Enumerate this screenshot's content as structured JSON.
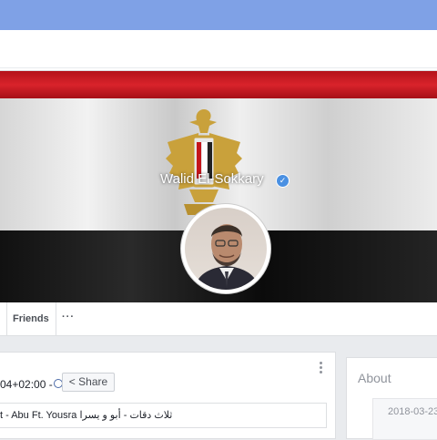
{
  "profile": {
    "name": "Walid El-Sokkary",
    "verified_icon": "verified-check-icon"
  },
  "tabs": {
    "friends_label": "Friends",
    "more_label": "···"
  },
  "post": {
    "timestamp": "04+02:00 -",
    "share_label": "Share",
    "text": "t - Abu Ft. Yousra ثلاث دقات - أبو و يسرا"
  },
  "about": {
    "title": "About",
    "date": "2018-03-23"
  },
  "colors": {
    "topbar": "#7fa1e6",
    "flag_red": "#d9232b",
    "flag_black": "#111111",
    "eagle_gold": "#c9a13b"
  }
}
